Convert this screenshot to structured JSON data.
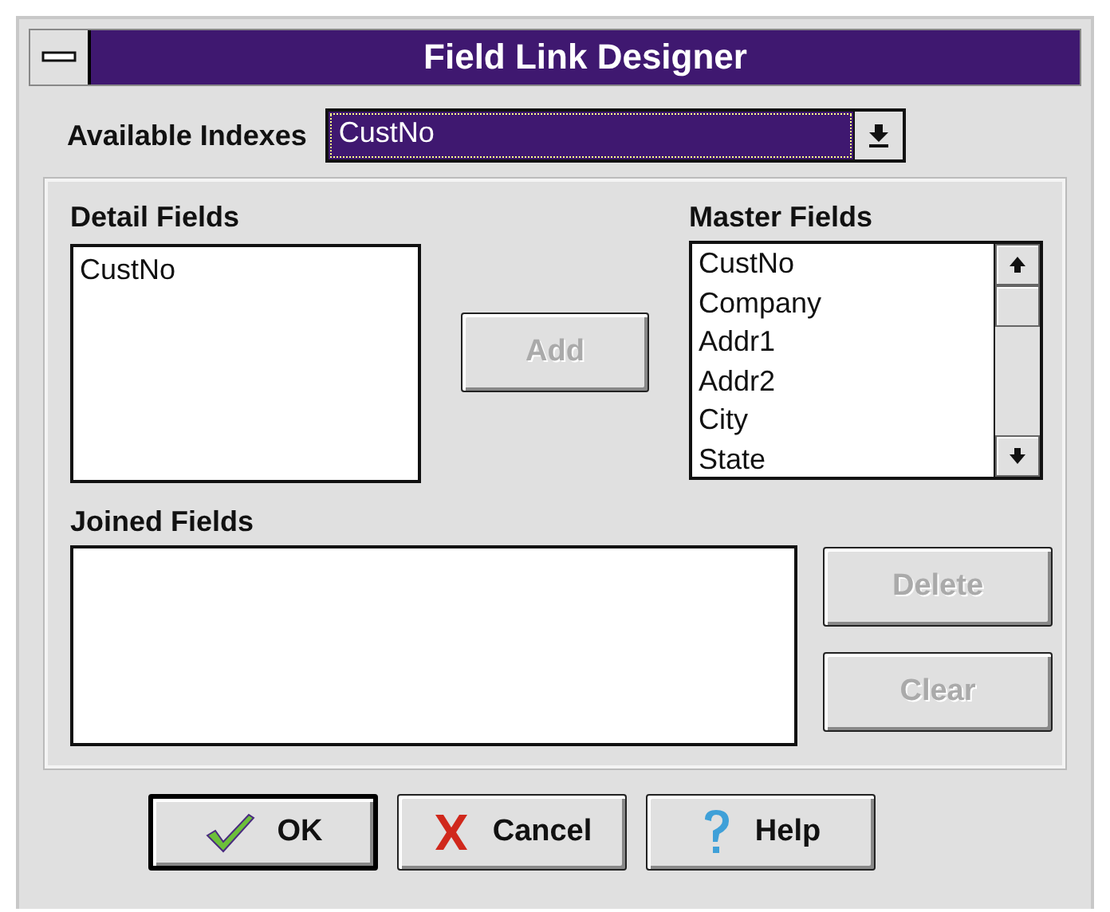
{
  "window": {
    "title": "Field Link Designer"
  },
  "available_indexes": {
    "label": "Available Indexes",
    "value": "CustNo"
  },
  "detail_fields": {
    "label": "Detail Fields",
    "items": [
      "CustNo"
    ]
  },
  "add_button": {
    "label": "Add",
    "disabled": true
  },
  "master_fields": {
    "label": "Master Fields",
    "items": [
      "CustNo",
      "Company",
      "Addr1",
      "Addr2",
      "City",
      "State"
    ]
  },
  "joined_fields": {
    "label": "Joined Fields"
  },
  "side_buttons": [
    {
      "label": "Delete",
      "disabled": true
    },
    {
      "label": "Clear",
      "disabled": true
    }
  ],
  "buttons": [
    {
      "kind": "ok",
      "label": "OK",
      "default": true
    },
    {
      "kind": "cancel",
      "label": "Cancel",
      "default": false
    },
    {
      "kind": "help",
      "label": "Help",
      "default": false
    }
  ]
}
